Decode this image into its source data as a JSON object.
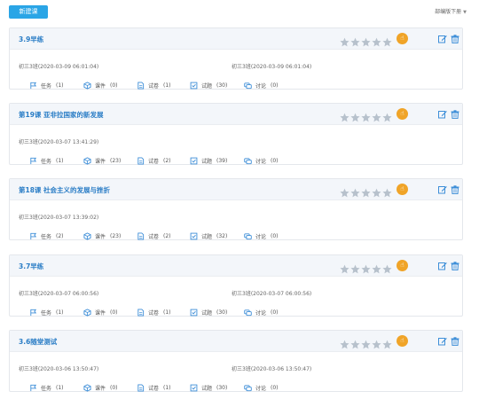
{
  "toolbar": {
    "new_button": "新建课",
    "version_label": "部编版下册",
    "caret": "▼"
  },
  "colors": {
    "accent": "#2aa5e6",
    "title": "#2a7dc6",
    "star": "#b7c1cc",
    "badge": "#f0a428",
    "icon": "#3d8ed8"
  },
  "stat_labels": {
    "task": "任务",
    "courseware": "课件",
    "paper": "试卷",
    "question": "试题",
    "discussion": "讨论"
  },
  "lessons": [
    {
      "title": "3.9早练",
      "meta_left": "初三3班(2020-03-09 06:01:04)",
      "meta_right": "初三3班(2020-03-09 06:01:04)",
      "task": "(1)",
      "courseware": "(0)",
      "paper": "(1)",
      "question": "(30)",
      "discussion": "(0)"
    },
    {
      "title": "第19课 亚非拉国家的新发展",
      "meta_left": "初三3班(2020-03-07 13:41:29)",
      "meta_right": "",
      "task": "(1)",
      "courseware": "(23)",
      "paper": "(2)",
      "question": "(39)",
      "discussion": "(0)"
    },
    {
      "title": "第18课 社会主义的发展与挫折",
      "meta_left": "初三3班(2020-03-07 13:39:02)",
      "meta_right": "",
      "task": "(2)",
      "courseware": "(23)",
      "paper": "(2)",
      "question": "(32)",
      "discussion": "(0)"
    },
    {
      "title": "3.7早练",
      "meta_left": "初三3班(2020-03-07 06:00:56)",
      "meta_right": "初三3班(2020-03-07 06:00:56)",
      "task": "(1)",
      "courseware": "(0)",
      "paper": "(1)",
      "question": "(30)",
      "discussion": "(0)"
    },
    {
      "title": "3.6随堂测试",
      "meta_left": "初三3班(2020-03-06 13:50:47)",
      "meta_right": "初三3班(2020-03-06 13:50:47)",
      "task": "(1)",
      "courseware": "(0)",
      "paper": "(1)",
      "question": "(30)",
      "discussion": "(0)"
    }
  ]
}
